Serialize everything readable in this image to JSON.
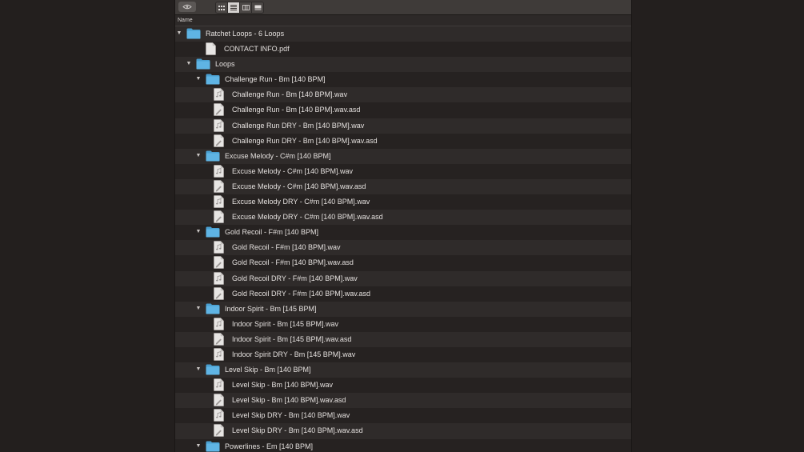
{
  "column": {
    "name": "Name"
  },
  "rows": [
    {
      "type": "folder",
      "level": 0,
      "name": "Ratchet Loops - 6 Loops"
    },
    {
      "type": "pdf",
      "level": 1,
      "name": "CONTACT INFO.pdf"
    },
    {
      "type": "folder",
      "level": 1,
      "name": "Loops"
    },
    {
      "type": "folder",
      "level": 2,
      "name": "Challenge Run - Bm [140 BPM]"
    },
    {
      "type": "audio",
      "level": 3,
      "name": "Challenge Run - Bm [140 BPM].wav"
    },
    {
      "type": "asd",
      "level": 3,
      "name": "Challenge Run - Bm [140 BPM].wav.asd"
    },
    {
      "type": "audio",
      "level": 3,
      "name": "Challenge Run DRY - Bm [140 BPM].wav"
    },
    {
      "type": "asd",
      "level": 3,
      "name": "Challenge Run DRY - Bm [140 BPM].wav.asd"
    },
    {
      "type": "folder",
      "level": 2,
      "name": "Excuse Melody - C#m [140 BPM]"
    },
    {
      "type": "audio",
      "level": 3,
      "name": "Excuse Melody - C#m [140 BPM].wav"
    },
    {
      "type": "asd",
      "level": 3,
      "name": "Excuse Melody - C#m [140 BPM].wav.asd"
    },
    {
      "type": "audio",
      "level": 3,
      "name": "Excuse Melody DRY - C#m [140 BPM].wav"
    },
    {
      "type": "asd",
      "level": 3,
      "name": "Excuse Melody DRY - C#m [140 BPM].wav.asd"
    },
    {
      "type": "folder",
      "level": 2,
      "name": "Gold Recoil - F#m [140 BPM]"
    },
    {
      "type": "audio",
      "level": 3,
      "name": "Gold Recoil - F#m [140 BPM].wav"
    },
    {
      "type": "asd",
      "level": 3,
      "name": "Gold Recoil - F#m [140 BPM].wav.asd"
    },
    {
      "type": "audio",
      "level": 3,
      "name": "Gold Recoil DRY - F#m [140 BPM].wav"
    },
    {
      "type": "asd",
      "level": 3,
      "name": "Gold Recoil DRY - F#m [140 BPM].wav.asd"
    },
    {
      "type": "folder",
      "level": 2,
      "name": "Indoor Spirit - Bm [145 BPM]"
    },
    {
      "type": "audio",
      "level": 3,
      "name": "Indoor Spirit - Bm [145 BPM].wav"
    },
    {
      "type": "asd",
      "level": 3,
      "name": "Indoor Spirit - Bm [145 BPM].wav.asd"
    },
    {
      "type": "audio",
      "level": 3,
      "name": "Indoor Spirit DRY - Bm [145 BPM].wav"
    },
    {
      "type": "folder",
      "level": 2,
      "name": "Level Skip - Bm [140 BPM]"
    },
    {
      "type": "audio",
      "level": 3,
      "name": "Level Skip - Bm [140 BPM].wav"
    },
    {
      "type": "asd",
      "level": 3,
      "name": "Level Skip - Bm [140 BPM].wav.asd"
    },
    {
      "type": "audio",
      "level": 3,
      "name": "Level Skip DRY - Bm [140 BPM].wav"
    },
    {
      "type": "asd",
      "level": 3,
      "name": "Level Skip DRY - Bm [140 BPM].wav.asd"
    },
    {
      "type": "folder",
      "level": 2,
      "name": "Powerlines - Em [140 BPM]"
    }
  ],
  "colors": {
    "folder": "#5fb4e4",
    "folder_tab": "#4a9fd0",
    "file": "#e7e5e3"
  }
}
